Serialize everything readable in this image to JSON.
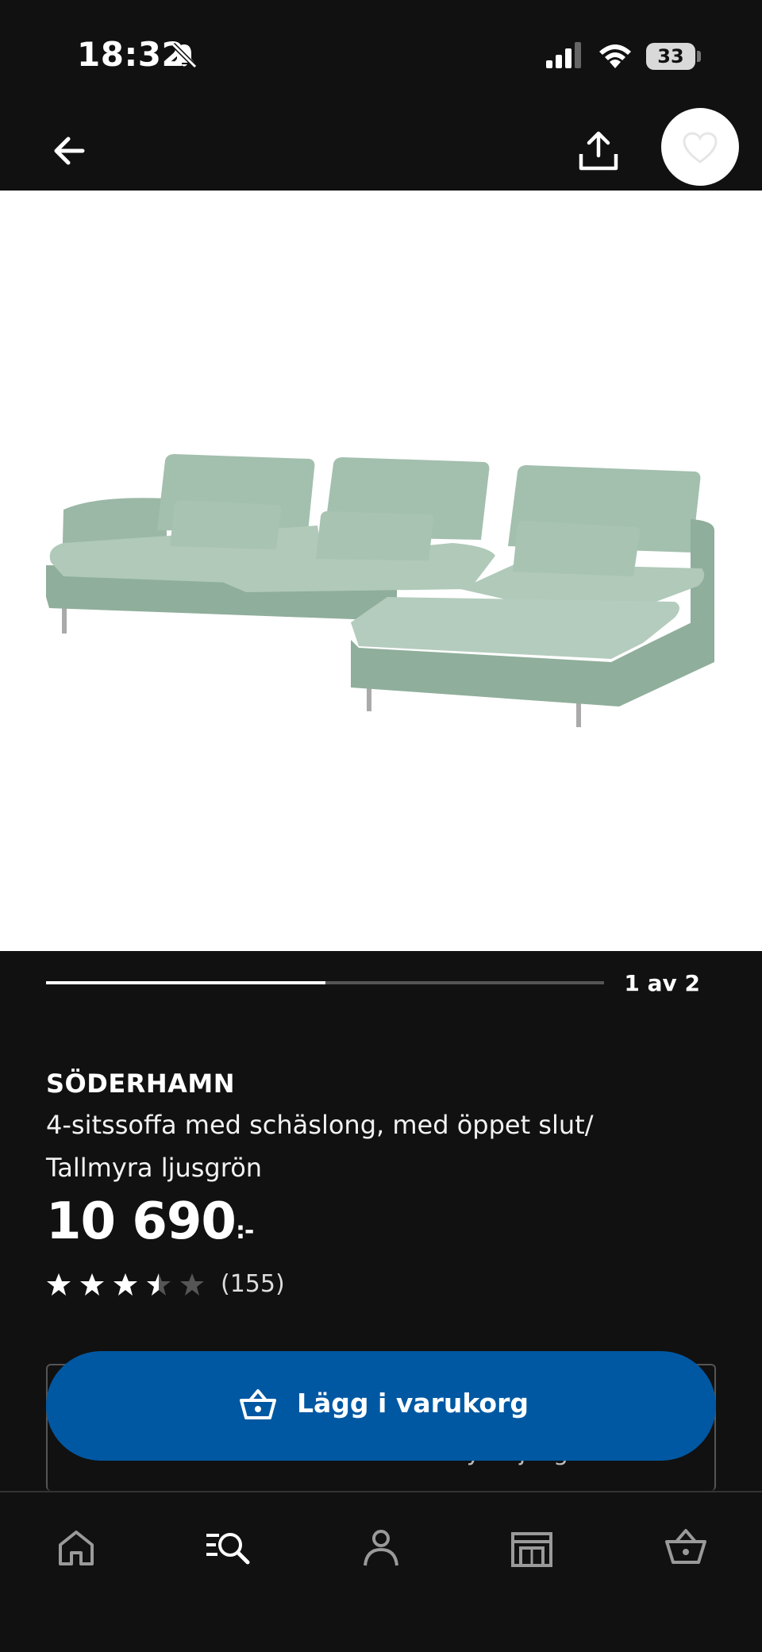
{
  "status_bar": {
    "time": "18:32",
    "battery_level": "33",
    "icons": [
      "bell-muted-icon",
      "signal-icon",
      "wifi-icon",
      "battery-icon"
    ]
  },
  "top_nav": {
    "icons": [
      "back-arrow-icon",
      "share-icon",
      "heart-icon"
    ]
  },
  "gallery": {
    "counter": "1 av 2",
    "progress": 0.5
  },
  "product": {
    "name": "SÖDERHAMN",
    "description": "4-sitssoffa med schäslong, med öppet slut/ Tallmyra ljusgrön",
    "price": "10 690",
    "price_suffix": ":-",
    "rating": 3.5,
    "rating_max": 5,
    "review_count": "(155)"
  },
  "variant": {
    "peek_text": "Tallmyra ljusgrön"
  },
  "cart_button": {
    "label": "Lägg i varukorg",
    "icon": "cart-basket-icon"
  },
  "bottom_nav": {
    "items": [
      "home-icon",
      "search-icon",
      "profile-icon",
      "store-icon",
      "basket-icon"
    ]
  },
  "colors": {
    "background": "#111111",
    "accent_blue": "#0058a3",
    "sofa_green": "#9bb8a6"
  }
}
